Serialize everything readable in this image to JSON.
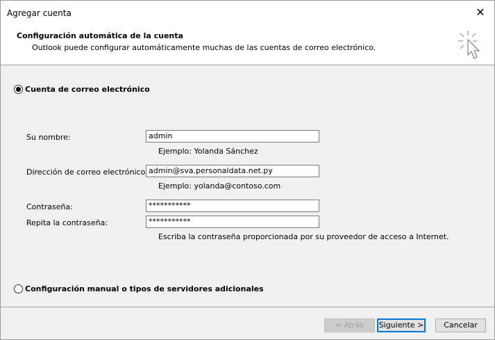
{
  "window": {
    "title": "Agregar cuenta",
    "close_glyph": "✕"
  },
  "header": {
    "title": "Configuración automática de la cuenta",
    "subtitle": "Outlook puede configurar automáticamente muchas de las cuentas de correo electrónico.",
    "icon": "wizard-cursor-icon"
  },
  "options": {
    "email_account": {
      "label": "Cuenta de correo electrónico",
      "selected": true
    },
    "manual": {
      "label": "Configuración manual o tipos de servidores adicionales",
      "selected": false
    }
  },
  "form": {
    "name": {
      "label": "Su nombre:",
      "value": "admin",
      "hint": "Ejemplo: Yolanda Sánchez"
    },
    "email": {
      "label": "Dirección de correo electrónico:",
      "value": "admin@sva.personaldata.net.py",
      "hint": "Ejemplo: yolanda@contoso.com"
    },
    "password": {
      "label": "Contraseña:",
      "value": "***********"
    },
    "password_repeat": {
      "label": "Repita la contraseña:",
      "value": "***********"
    },
    "password_hint": "Escriba la contraseña proporcionada por su proveedor de acceso a Internet."
  },
  "buttons": {
    "back": "< Atrás",
    "next": "Siguiente >",
    "cancel": "Cancelar"
  },
  "colors": {
    "accent": "#0078d7",
    "background": "#f0f0f0",
    "header": "#ffffff"
  }
}
